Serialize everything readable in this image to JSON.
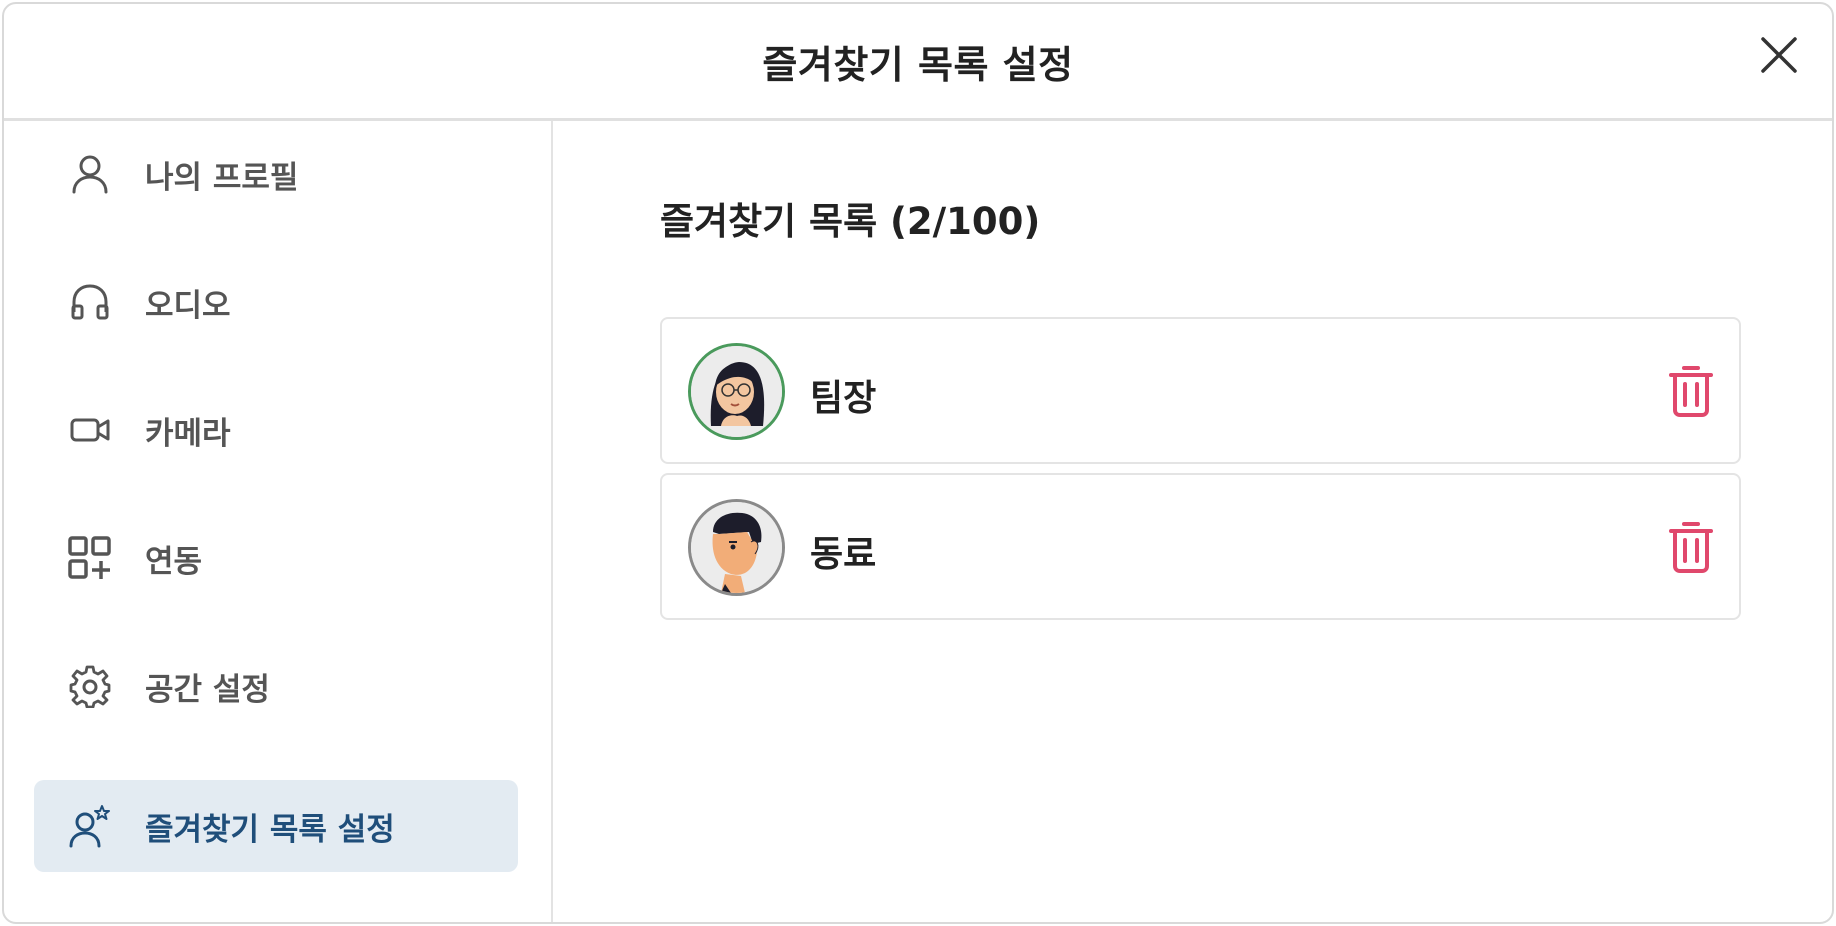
{
  "dialog": {
    "title": "즐겨찾기 목록 설정",
    "close_icon": "close-icon"
  },
  "sidebar": {
    "items": [
      {
        "label": "나의 프로필",
        "icon": "person-icon",
        "active": false
      },
      {
        "label": "오디오",
        "icon": "headphones-icon",
        "active": false
      },
      {
        "label": "카메라",
        "icon": "camera-icon",
        "active": false
      },
      {
        "label": "연동",
        "icon": "apps-add-icon",
        "active": false
      },
      {
        "label": "공간 설정",
        "icon": "gear-icon",
        "active": false
      },
      {
        "label": "즐겨찾기 목록 설정",
        "icon": "person-star-icon",
        "active": true
      }
    ]
  },
  "main": {
    "section_title": "즐겨찾기 목록 (2/100)",
    "favorites": [
      {
        "name": "팀장",
        "avatar": "woman-avatar",
        "ring_color": "#4a9a5c"
      },
      {
        "name": "동료",
        "avatar": "man-avatar",
        "ring_color": "#8a8a8a"
      }
    ]
  },
  "colors": {
    "accent_active_bg": "#e3ebf2",
    "accent_active_text": "#1f4e7a",
    "delete": "#e0486c",
    "icon": "#555555"
  }
}
